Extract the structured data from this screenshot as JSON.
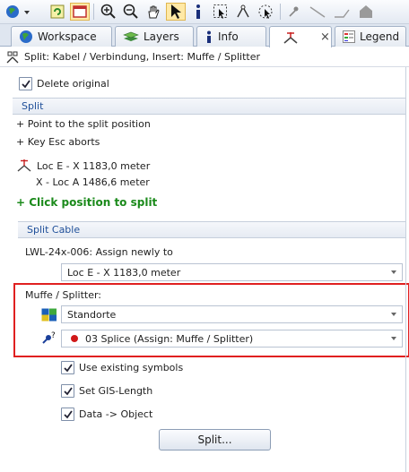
{
  "tabs": [
    {
      "label": "Workspace",
      "icon": "globe-icon"
    },
    {
      "label": "Layers",
      "icon": "layers-icon"
    },
    {
      "label": "Info",
      "icon": "info-icon"
    },
    {
      "label": "",
      "icon": "split-tool-icon",
      "active": true,
      "close": "×"
    },
    {
      "label": "Legend",
      "icon": "legend-icon"
    }
  ],
  "header": {
    "title": "Split: Kabel / Verbindung, Insert: Muffe / Splitter"
  },
  "options": {
    "delete_original": "Delete original"
  },
  "split_section": {
    "title": "Split",
    "hint_point": "+ Point to the split position",
    "hint_esc": "+ Key Esc aborts",
    "loc_e": "Loc E - X  1183,0 meter",
    "loc_a": "X - Loc A  1486,6 meter",
    "click_hint": "+ Click position to split"
  },
  "split_cable": {
    "title": "Split Cable",
    "assign_label": "LWL-24x-006: Assign newly to",
    "assign_value": "Loc E - X  1183,0 meter"
  },
  "muffe": {
    "label": "Muffe / Splitter:",
    "location_value": "Standorte",
    "splice_value": "03 Splice (Assign: Muffe / Splitter)"
  },
  "checks": {
    "use_existing": "Use existing symbols",
    "set_gis": "Set GIS-Length",
    "data_object": "Data -> Object"
  },
  "actions": {
    "split_button": "Split..."
  },
  "colors": {
    "accent_blue": "#1f4f99",
    "highlight": "#e02020",
    "green": "#1b8a1b"
  }
}
